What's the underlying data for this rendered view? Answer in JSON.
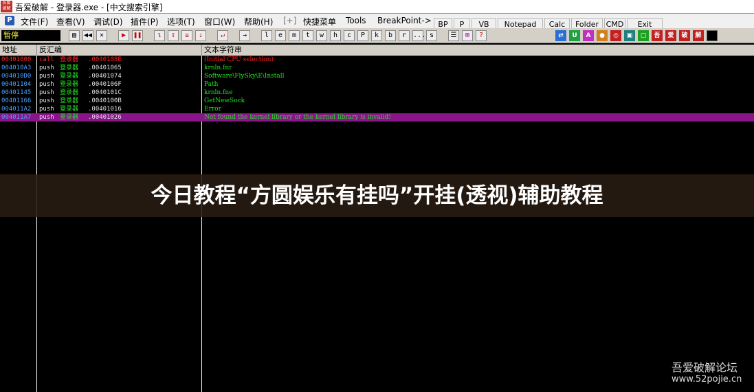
{
  "window": {
    "title": "吾爱破解 - 登录器.exe - [中文搜索引擎]",
    "app_icon_text": "吾爱破解"
  },
  "menubar": {
    "items": [
      "文件(F)",
      "查看(V)",
      "调试(D)",
      "插件(P)",
      "选项(T)",
      "窗口(W)",
      "帮助(H)",
      "[+]",
      "快捷菜单",
      "Tools",
      "BreakPoint->"
    ],
    "buttons": [
      "BP",
      "P",
      "VB",
      "Notepad",
      "Calc",
      "Folder",
      "CMD",
      "Exit"
    ]
  },
  "toolbar": {
    "status": "暂停",
    "letter_buttons": [
      "l",
      "e",
      "m",
      "t",
      "w",
      "h",
      "c",
      "P",
      "k",
      "b",
      "r",
      "...",
      "s"
    ],
    "right_buttons": [
      "吾",
      "爱",
      "破",
      "解"
    ]
  },
  "columns": {
    "address": "地址",
    "disasm": "反汇编",
    "text": "文本字符串"
  },
  "rows": [
    {
      "addr": "00401000",
      "op": "call",
      "arg": "登录器",
      "num": ".0040108E",
      "str": "(Initial CPU selection)",
      "color": "#ff2020"
    },
    {
      "addr": "004010A3",
      "op": "push",
      "arg": "登录器",
      "num": ".00401065",
      "str": "krnln.fnr",
      "color": "#20e020"
    },
    {
      "addr": "004010D0",
      "op": "push",
      "arg": "登录器",
      "num": ".00401074",
      "str": "Software\\FlySky\\E\\Install",
      "color": "#20e020"
    },
    {
      "addr": "00401104",
      "op": "push",
      "arg": "登录器",
      "num": ".0040106F",
      "str": "Path",
      "color": "#20e020"
    },
    {
      "addr": "00401145",
      "op": "push",
      "arg": "登录器",
      "num": ".0040101C",
      "str": "krnln.fne",
      "color": "#20e020"
    },
    {
      "addr": "00401166",
      "op": "push",
      "arg": "登录器",
      "num": ".0040100B",
      "str": "GetNewSock",
      "color": "#20e020"
    },
    {
      "addr": "004011A2",
      "op": "push",
      "arg": "登录器",
      "num": ".00401016",
      "str": "Error",
      "color": "#20e020"
    },
    {
      "addr": "004011A7",
      "op": "push",
      "arg": "登录器",
      "num": ".00401026",
      "str": "Not found the kernel library or the kernel library is invalid!",
      "color": "#20e020"
    }
  ],
  "banner": {
    "text": "今日教程“方圆娱乐有挂吗”开挂(透视)辅助教程"
  },
  "watermark": {
    "line1": "吾爱破解论坛",
    "line2": "www.52pojie.cn"
  }
}
